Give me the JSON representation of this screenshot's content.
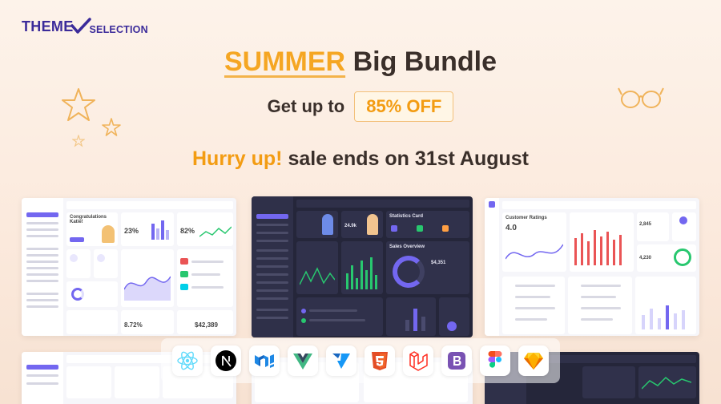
{
  "brand": {
    "logo_theme": "THEME",
    "logo_selection": "SELECTION",
    "brand_color": "#3b2b9a"
  },
  "banner": {
    "headline_highlight": "SUMMER",
    "headline_rest": "Big Bundle",
    "offer_prefix": "Get up to",
    "offer_badge": "85% OFF",
    "hurry_highlight": "Hurry up!",
    "hurry_rest": "sale ends on 31st August",
    "accent_color": "#f39c12"
  },
  "previews": {
    "light_left": {
      "title": "Congratulations Katie!",
      "stat1": "23%",
      "stat2": "82%",
      "stat3": "$42,389",
      "stat4": "8.72%"
    },
    "dark_center": {
      "title": "Statistics Card",
      "stat1": "24.9k",
      "stat2": "$4,351",
      "stat3": "Sales Overview"
    },
    "light_right": {
      "title": "Customer Ratings",
      "stat1": "4.0",
      "stat2": "2,845",
      "stat3": "4,230"
    }
  },
  "tech_stack": [
    {
      "name": "React",
      "icon": "react-icon",
      "color": "#61dafb"
    },
    {
      "name": "Next.js",
      "icon": "nextjs-icon",
      "color": "#000000"
    },
    {
      "name": "MUI",
      "icon": "mui-icon",
      "color": "#1e88e5"
    },
    {
      "name": "Vue",
      "icon": "vue-icon",
      "color": "#41b883"
    },
    {
      "name": "Vuetify",
      "icon": "vuetify-icon",
      "color": "#1697f6"
    },
    {
      "name": "HTML5",
      "icon": "html5-icon",
      "color": "#e44d26"
    },
    {
      "name": "Laravel",
      "icon": "laravel-icon",
      "color": "#ff2d20"
    },
    {
      "name": "Bootstrap",
      "icon": "bootstrap-icon",
      "color": "#7952b3"
    },
    {
      "name": "Figma",
      "icon": "figma-icon",
      "color": "#f24e1e"
    },
    {
      "name": "Sketch",
      "icon": "sketch-icon",
      "color": "#fdb300"
    }
  ]
}
